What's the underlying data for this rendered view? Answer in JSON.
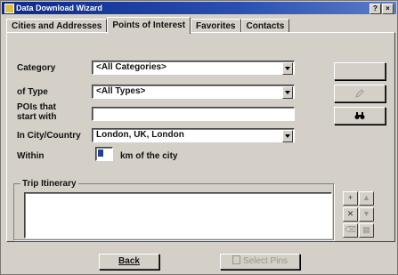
{
  "window": {
    "title": "Data Download Wizard"
  },
  "tabs": [
    {
      "label": "Cities and Addresses"
    },
    {
      "label": "Points of Interest",
      "active": true
    },
    {
      "label": "Favorites"
    },
    {
      "label": "Contacts"
    }
  ],
  "filters": {
    "category_label": "Category",
    "category_value": "<All Categories>",
    "type_label": "of Type",
    "type_value": "<All Types>",
    "poi_label_line1": "POIs that",
    "poi_label_line2": "start with",
    "poi_value": "",
    "city_label": "In City/Country",
    "city_value": "London, UK, London",
    "within_label": "Within",
    "within_units": "km of the city"
  },
  "side_buttons": {
    "find_icon": "binoculars-icon",
    "edit_icon": "pencil-icon"
  },
  "itinerary": {
    "label": "Trip Itinerary",
    "action_icons": [
      "add-icon",
      "up-icon",
      "remove-icon",
      "down-icon",
      "clear-icon",
      "map-icon"
    ]
  },
  "footer": {
    "back_label": "Back",
    "select_pins_label": "Select Pins"
  }
}
